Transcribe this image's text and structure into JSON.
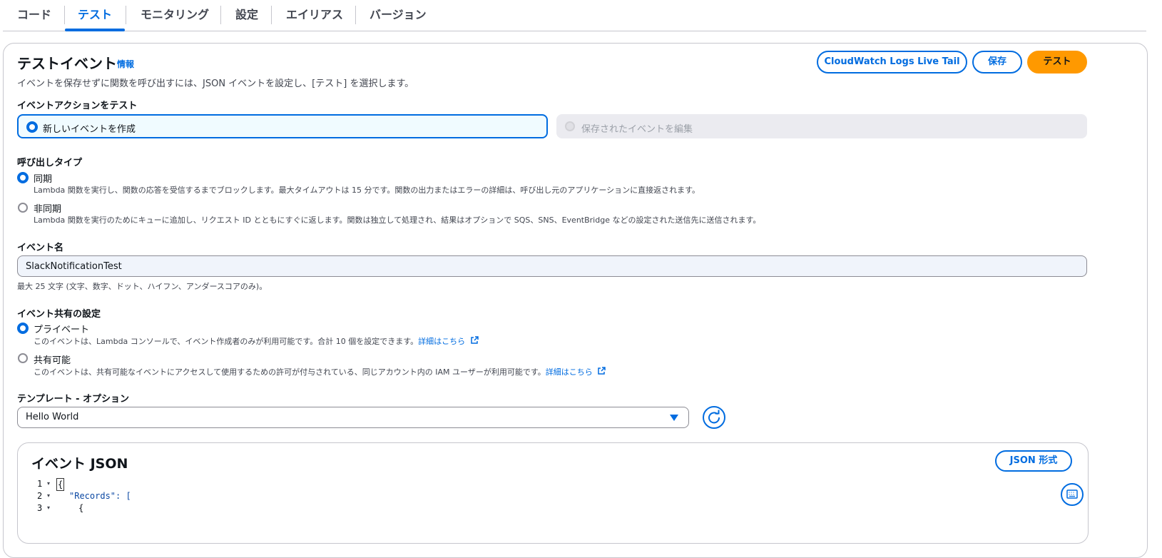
{
  "tabs": [
    {
      "label": "コード"
    },
    {
      "label": "テスト"
    },
    {
      "label": "モニタリング"
    },
    {
      "label": "設定"
    },
    {
      "label": "エイリアス"
    },
    {
      "label": "バージョン"
    }
  ],
  "active_tab": "テスト",
  "panel": {
    "title": "テストイベント",
    "info_link": "情報",
    "description": "イベントを保存せずに関数を呼び出すには、JSON イベントを設定し、[テスト] を選択します。",
    "buttons": {
      "live_tail": "CloudWatch Logs Live Tail",
      "save": "保存",
      "test": "テスト"
    }
  },
  "event_action": {
    "label": "イベントアクションをテスト",
    "create_new": "新しいイベントを作成",
    "edit_saved": "保存されたイベントを編集"
  },
  "invocation_type": {
    "label": "呼び出しタイプ",
    "sync_title": "同期",
    "sync_desc": "Lambda 関数を実行し、関数の応答を受信するまでブロックします。最大タイムアウトは 15 分です。関数の出力またはエラーの詳細は、呼び出し元のアプリケーションに直接返されます。",
    "async_title": "非同期",
    "async_desc": "Lambda 関数を実行のためにキューに追加し、リクエスト ID とともにすぐに返します。関数は独立して処理され、結果はオプションで SQS、SNS、EventBridge などの設定された送信先に送信されます。"
  },
  "event_name": {
    "label": "イベント名",
    "value": "SlackNotificationTest",
    "hint": "最大 25 文字 (文字、数字、ドット、ハイフン、アンダースコアのみ)。"
  },
  "sharing": {
    "label": "イベント共有の設定",
    "private_title": "プライベート",
    "private_desc": "このイベントは、Lambda コンソールで、イベント作成者のみが利用可能です。合計 10 個を設定できます。",
    "shareable_title": "共有可能",
    "shareable_desc": "このイベントは、共有可能なイベントにアクセスして使用するための許可が付与されている、同じアカウント内の IAM ユーザーが利用可能です。",
    "learn_more": "詳細はこちら"
  },
  "template": {
    "label": "テンプレート - オプション",
    "selected": "Hello World"
  },
  "event_json": {
    "title": "イベント JSON",
    "format_button": "JSON 形式",
    "lines": [
      {
        "num": "1",
        "text": "{"
      },
      {
        "num": "2",
        "text": "\"Records\": ["
      },
      {
        "num": "3",
        "text": "{"
      }
    ]
  },
  "colors": {
    "accent": "#006ce0",
    "primary_button": "#ff9900"
  },
  "icons": [
    "external-link-icon",
    "refresh-icon",
    "keyboard-icon",
    "caret-down-icon"
  ]
}
